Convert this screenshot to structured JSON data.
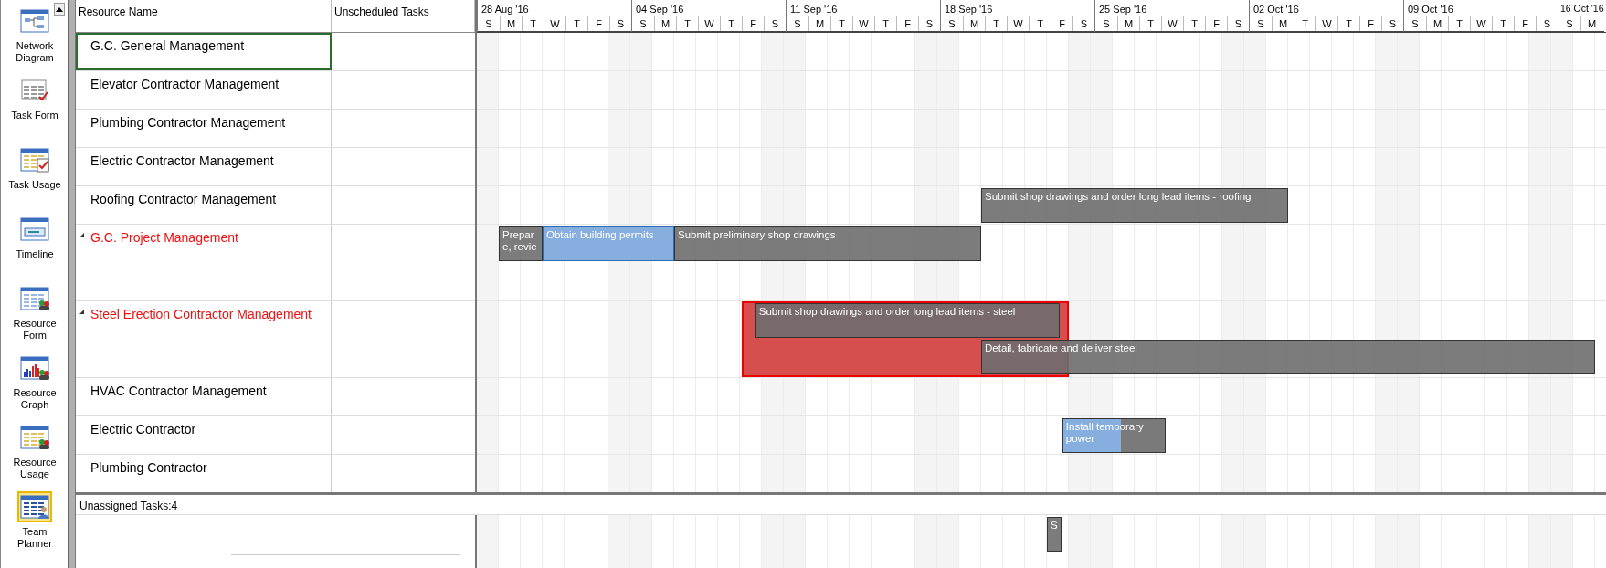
{
  "sidebar": {
    "items": [
      {
        "label": "Network Diagram",
        "kind": "network",
        "selected": false
      },
      {
        "label": "Task Form",
        "kind": "form",
        "selected": false
      },
      {
        "label": "Task Usage",
        "kind": "usage",
        "selected": false
      },
      {
        "label": "Timeline",
        "kind": "timeline",
        "selected": false
      },
      {
        "label": "Resource Form",
        "kind": "resform",
        "selected": false
      },
      {
        "label": "Resource Graph",
        "kind": "resgraph",
        "selected": false
      },
      {
        "label": "Resource Usage",
        "kind": "resusage",
        "selected": false
      },
      {
        "label": "Team Planner",
        "kind": "team",
        "selected": true
      }
    ]
  },
  "columns": [
    "Resource Name",
    "Unscheduled Tasks"
  ],
  "timeline": {
    "weeks": [
      {
        "label": "28 Aug '16",
        "days": [
          "S",
          "M",
          "T",
          "W",
          "T",
          "F",
          "S"
        ]
      },
      {
        "label": "04 Sep '16",
        "days": [
          "S",
          "M",
          "T",
          "W",
          "T",
          "F",
          "S"
        ]
      },
      {
        "label": "11 Sep '16",
        "days": [
          "S",
          "M",
          "T",
          "W",
          "T",
          "F",
          "S"
        ]
      },
      {
        "label": "18 Sep '16",
        "days": [
          "S",
          "M",
          "T",
          "W",
          "T",
          "F",
          "S"
        ]
      },
      {
        "label": "25 Sep '16",
        "days": [
          "S",
          "M",
          "T",
          "W",
          "T",
          "F",
          "S"
        ]
      },
      {
        "label": "02 Oct '16",
        "days": [
          "S",
          "M",
          "T",
          "W",
          "T",
          "F",
          "S"
        ]
      },
      {
        "label": "09 Oct '16",
        "days": [
          "S",
          "M",
          "T",
          "W",
          "T",
          "F",
          "S"
        ]
      },
      {
        "label": "16 Oct '16",
        "days": [
          "S",
          "M"
        ]
      }
    ]
  },
  "resources": [
    {
      "name": "G.C. General Management",
      "selected": true,
      "overallocated": false
    },
    {
      "name": "Elevator Contractor Management",
      "selected": false,
      "overallocated": false
    },
    {
      "name": "Plumbing Contractor Management",
      "selected": false,
      "overallocated": false
    },
    {
      "name": "Electric Contractor Management",
      "selected": false,
      "overallocated": false
    },
    {
      "name": "Roofing Contractor Management",
      "selected": false,
      "overallocated": false,
      "bars": [
        {
          "label": "Submit shop drawings and order long lead items - roofing",
          "kind": "manual"
        }
      ]
    },
    {
      "name": "G.C. Project Management",
      "selected": false,
      "overallocated": true,
      "expanded": true,
      "bars": [
        {
          "label": "Prepare, revie",
          "kind": "manual"
        },
        {
          "label": "Obtain building permits",
          "kind": "auto"
        },
        {
          "label": "Submit preliminary shop drawings",
          "kind": "manual"
        }
      ]
    },
    {
      "name": "Steel Erection Contractor Management",
      "selected": false,
      "overallocated": true,
      "expanded": true,
      "bars": [
        {
          "label": "Submit shop drawings and order long lead items - steel",
          "kind": "manual"
        },
        {
          "label": "Detail, fabricate and deliver steel",
          "kind": "manual"
        }
      ]
    },
    {
      "name": "HVAC Contractor Management",
      "selected": false,
      "overallocated": false
    },
    {
      "name": "Electric Contractor",
      "selected": false,
      "overallocated": false,
      "bars": [
        {
          "label": "Install temporary power",
          "kind": "mixed",
          "level": 0.57
        }
      ]
    },
    {
      "name": "Plumbing Contractor",
      "selected": false,
      "overallocated": false
    }
  ],
  "unassigned": {
    "title": "Unassigned Tasks:4",
    "bars": [
      {
        "label": "S",
        "kind": "manual"
      }
    ]
  }
}
